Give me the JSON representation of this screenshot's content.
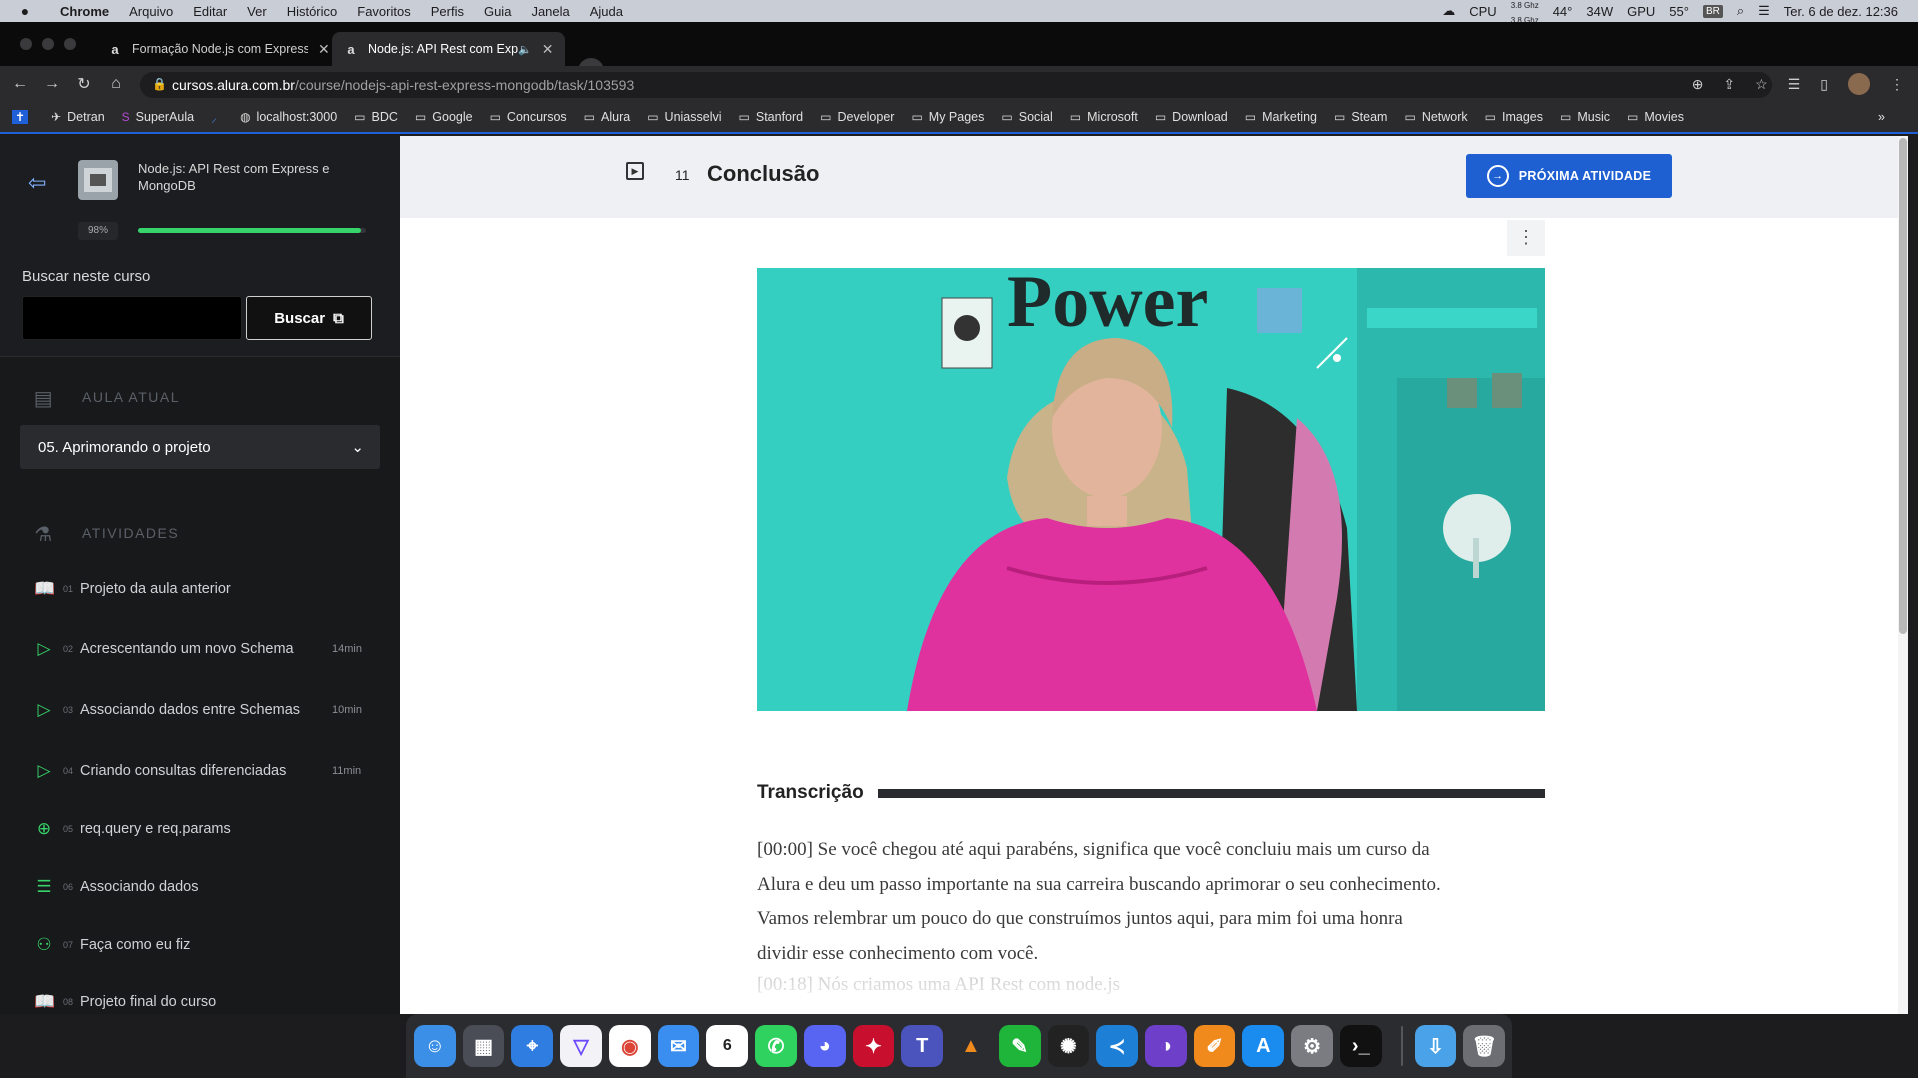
{
  "menubar": {
    "apple": "",
    "app": "Chrome",
    "items": [
      "Arquivo",
      "Editar",
      "Ver",
      "Histórico",
      "Favoritos",
      "Perfis",
      "Guia",
      "Janela",
      "Ajuda"
    ],
    "status": {
      "cpu": "CPU",
      "cpu_freq_top": "3.8 Ghz",
      "cpu_freq_bottom": "3.8 Ghz",
      "temp": "44°",
      "watts": "34W",
      "gpu": "GPU",
      "gpu_temp": "55°",
      "lang": "BR",
      "datetime": "Ter. 6 de dez.  12:36"
    }
  },
  "tabs": [
    {
      "title": "Formação Node.js com Express",
      "favicon": "a",
      "active": false
    },
    {
      "title": "Node.js: API Rest com Expr",
      "favicon": "a",
      "active": true
    }
  ],
  "newtab": "+",
  "address": {
    "domain": "cursos.alura.com.br",
    "path": "/course/nodejs-api-rest-express-mongodb/task/103593"
  },
  "bookmarks": [
    "Detran",
    "SuperAula",
    "localhost:3000",
    "BDC",
    "Google",
    "Concursos",
    "Alura",
    "Uniasselvi",
    "Stanford",
    "Developer",
    "My Pages",
    "Social",
    "Microsoft",
    "Download",
    "Marketing",
    "Steam",
    "Network",
    "Images",
    "Music",
    "Movies"
  ],
  "bookmarks_more": "»",
  "sidebar": {
    "course_title": "Node.js: API Rest com Express e MongoDB",
    "progress_label": "98%",
    "progress": 0.98,
    "search_label": "Buscar neste curso",
    "search_placeholder": "",
    "search_button": "Buscar",
    "current_section": "AULA ATUAL",
    "current_lesson": "05. Aprimorando o projeto",
    "activities_section": "ATIVIDADES",
    "activities": [
      {
        "num": "01",
        "label": "Projeto da aula anterior",
        "dur": "",
        "icon": "book-icon"
      },
      {
        "num": "02",
        "label": "Acrescentando um novo Schema",
        "dur": "14min",
        "icon": "video-icon"
      },
      {
        "num": "03",
        "label": "Associando dados entre Schemas",
        "dur": "10min",
        "icon": "video-icon"
      },
      {
        "num": "04",
        "label": "Criando consultas diferenciadas",
        "dur": "11min",
        "icon": "video-icon"
      },
      {
        "num": "05",
        "label": "req.query e req.params",
        "dur": "",
        "icon": "plus-circle-icon"
      },
      {
        "num": "06",
        "label": "Associando dados",
        "dur": "",
        "icon": "list-icon"
      },
      {
        "num": "07",
        "label": "Faça como eu fiz",
        "dur": "",
        "icon": "people-icon"
      },
      {
        "num": "08",
        "label": "Projeto final do curso",
        "dur": "",
        "icon": "book-icon"
      }
    ]
  },
  "task": {
    "number": "11",
    "title": "Conclusão",
    "next_button": "PRÓXIMA ATIVIDADE"
  },
  "transcript": {
    "heading": "Transcrição",
    "p1": "[00:00] Se você chegou até aqui parabéns, significa que você concluiu mais um curso da Alura e deu um passo importante na sua carreira buscando aprimorar o seu conhecimento. Vamos relembrar um pouco do que construímos juntos aqui, para mim foi uma honra dividir esse conhecimento com você.",
    "p2": "[00:18] Nós criamos uma API Rest com node.js"
  },
  "video": {
    "wall_text": "Power"
  },
  "dock": [
    "Finder",
    "Launchpad",
    "Safari",
    "Proton VPN",
    "Chrome",
    "Mail",
    "Calendar",
    "WhatsApp",
    "Discord",
    "Unknown",
    "Teams",
    "VLC",
    "Pen",
    "Utility",
    "VS Code",
    "GitHub Desktop",
    "Pencil",
    "App Store",
    "System Settings",
    "Terminal",
    "Downloads",
    "Trash"
  ],
  "colors": {
    "accent": "#1e5fd1",
    "progress": "#36d46a",
    "sidebar_bg": "#18191b",
    "topbar_bg": "#eef0f3"
  }
}
